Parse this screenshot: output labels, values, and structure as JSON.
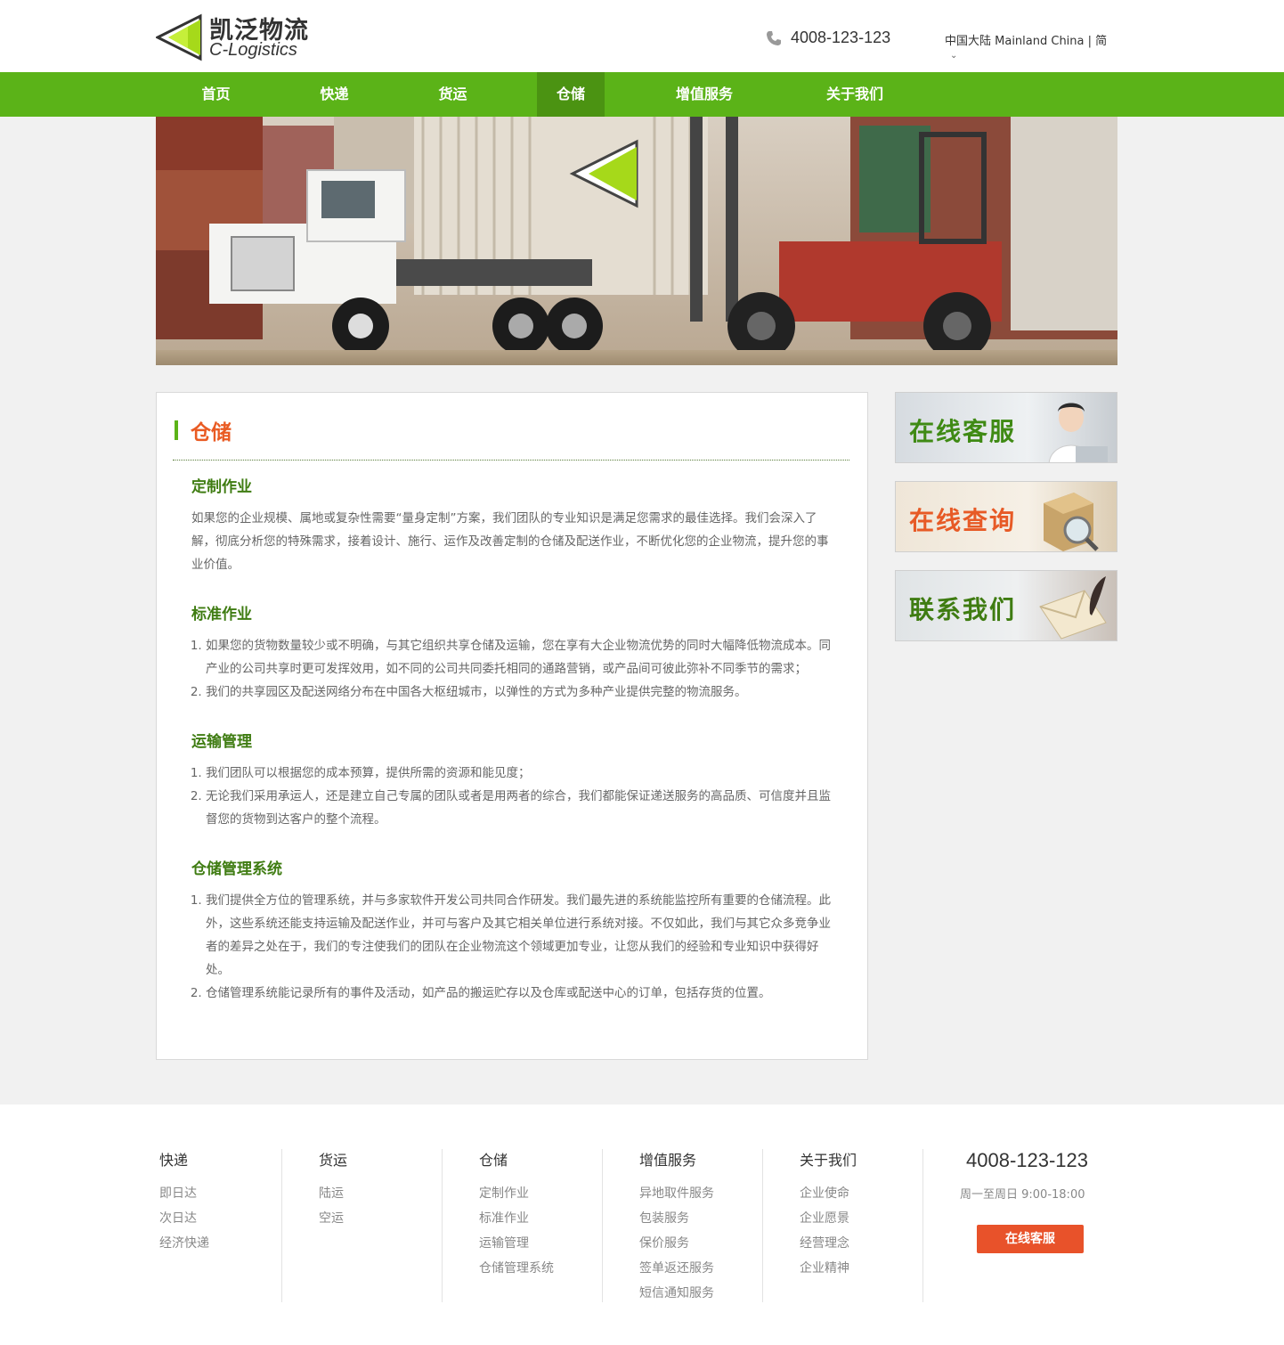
{
  "header": {
    "logo_cn": "凯泛物流",
    "logo_en": "C-Logistics",
    "phone": "4008-123-123",
    "region": "中国大陆 Mainland China | 简"
  },
  "nav": {
    "items": [
      "首页",
      "快递",
      "货运",
      "仓储",
      "增值服务",
      "关于我们"
    ],
    "active": "仓储"
  },
  "article": {
    "title": "仓储",
    "sections": [
      {
        "heading": "定制作业",
        "paragraph": "如果您的企业规模、属地或复杂性需要“量身定制”方案，我们团队的专业知识是满足您需求的最佳选择。我们会深入了解，彻底分析您的特殊需求，接着设计、施行、运作及改善定制的仓储及配送作业，不断优化您的企业物流，提升您的事业价值。"
      },
      {
        "heading": "标准作业",
        "items": [
          "如果您的货物数量较少或不明确，与其它组织共享仓储及运输，您在享有大企业物流优势的同时大幅降低物流成本。同产业的公司共享时更可发挥效用，如不同的公司共同委托相同的通路营销，或产品间可彼此弥补不同季节的需求；",
          "我们的共享园区及配送网络分布在中国各大枢纽城市，以弹性的方式为多种产业提供完整的物流服务。"
        ]
      },
      {
        "heading": "运输管理",
        "items": [
          "我们团队可以根据您的成本预算，提供所需的资源和能见度；",
          "无论我们采用承运人，还是建立自己专属的团队或者是用两者的综合，我们都能保证递送服务的高品质、可信度并且监督您的货物到达客户的整个流程。"
        ]
      },
      {
        "heading": "仓储管理系统",
        "items": [
          "我们提供全方位的管理系统，并与多家软件开发公司共同合作研发。我们最先进的系统能监控所有重要的仓储流程。此外，这些系统还能支持运输及配送作业，并可与客户及其它相关单位进行系统对接。不仅如此，我们与其它众多竞争业者的差异之处在于，我们的专注使我们的团队在企业物流这个领域更加专业，让您从我们的经验和专业知识中获得好处。",
          "仓储管理系统能记录所有的事件及活动，如产品的搬运贮存以及仓库或配送中心的订单，包括存货的位置。"
        ]
      }
    ]
  },
  "side": {
    "online_service": "在线客服",
    "online_query": "在线查询",
    "contact_us": "联系我们"
  },
  "footer": {
    "columns": [
      {
        "title": "快递",
        "links": [
          "即日达",
          "次日达",
          "经济快递"
        ]
      },
      {
        "title": "货运",
        "links": [
          "陆运",
          "空运"
        ]
      },
      {
        "title": "仓储",
        "links": [
          "定制作业",
          "标准作业",
          "运输管理",
          "仓储管理系统"
        ]
      },
      {
        "title": "增值服务",
        "links": [
          "异地取件服务",
          "包装服务",
          "保价服务",
          "签单返还服务",
          "短信通知服务"
        ]
      },
      {
        "title": "关于我们",
        "links": [
          "企业使命",
          "企业愿景",
          "经营理念",
          "企业精神"
        ]
      }
    ],
    "phone": "4008-123-123",
    "hours": "周一至周日  9:00-18:00",
    "service_button": "在线客服"
  },
  "colors": {
    "brand_green": "#5bb318",
    "nav_active": "#4b9312",
    "title_orange": "#e95b23",
    "heading_green": "#3f7c12",
    "button_orange": "#e8522a"
  }
}
